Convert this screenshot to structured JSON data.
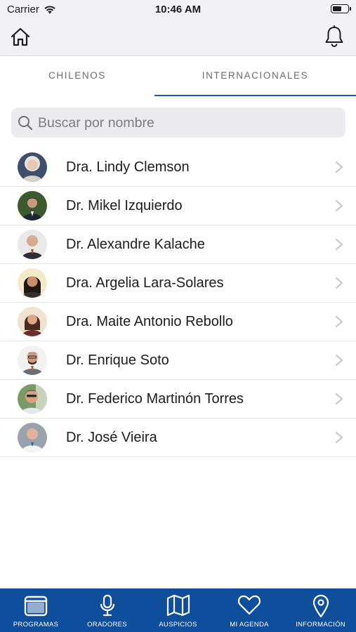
{
  "status_bar": {
    "carrier": "Carrier",
    "time": "10:46 AM"
  },
  "nav": {
    "home_icon": "home-icon",
    "bell_icon": "bell-icon"
  },
  "tabs": [
    {
      "label": "CHILENOS",
      "selected": false
    },
    {
      "label": "INTERNACIONALES",
      "selected": true
    }
  ],
  "search": {
    "placeholder": "Buscar por nombre",
    "value": ""
  },
  "speakers": [
    {
      "name": "Dra. Lindy Clemson"
    },
    {
      "name": "Dr. Mikel Izquierdo"
    },
    {
      "name": "Dr. Alexandre Kalache"
    },
    {
      "name": "Dra. Argelia Lara-Solares"
    },
    {
      "name": "Dra. Maite Antonio Rebollo"
    },
    {
      "name": "Dr. Enrique Soto"
    },
    {
      "name": "Dr. Federico Martinón Torres"
    },
    {
      "name": "Dr. José Vieira"
    }
  ],
  "bottom_tabs": [
    {
      "label": "PROGRAMAS",
      "icon": "calendar-icon"
    },
    {
      "label": "ORADORES",
      "icon": "microphone-icon"
    },
    {
      "label": "AUSPICIOS",
      "icon": "map-icon"
    },
    {
      "label": "MI AGENDA",
      "icon": "heart-icon"
    },
    {
      "label": "INFORMACIÓN",
      "icon": "location-pin-icon"
    }
  ],
  "colors": {
    "accent": "#1a5aa6",
    "tabbar_background": "#0f4e9b",
    "header_background": "#f2f2f4"
  }
}
